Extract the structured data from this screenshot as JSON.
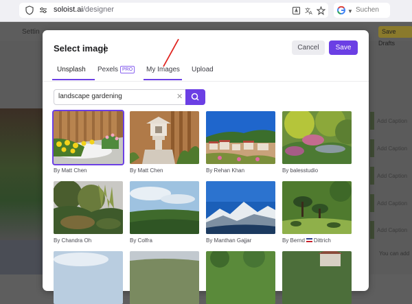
{
  "browser": {
    "url_domain": "soloist.ai",
    "url_path": "/designer",
    "search_placeholder": "Suchen"
  },
  "background": {
    "settings_label": "Settin",
    "save_draft_label": "Save Drafts",
    "caption_label": "Add Caption",
    "you_can_text": "You can add"
  },
  "modal": {
    "title": "Select image",
    "cancel_label": "Cancel",
    "save_label": "Save",
    "tabs": [
      {
        "label": "Unsplash",
        "active": true
      },
      {
        "label": "Pexels",
        "badge": "PRO",
        "active": false
      },
      {
        "label": "My Images",
        "active": false
      },
      {
        "label": "Upload",
        "active": false
      }
    ],
    "search": {
      "value": "landscape gardening",
      "clear_icon": "close-icon",
      "button_icon": "search-icon"
    },
    "images": [
      {
        "credit": "By Matt Chen",
        "selected": true
      },
      {
        "credit": "By Matt Chen"
      },
      {
        "credit": "By Rehan Khan"
      },
      {
        "credit": "By balesstudio"
      },
      {
        "credit": "By Chandra Oh"
      },
      {
        "credit": "By Colfra"
      },
      {
        "credit": "By Manthan Gajjar"
      },
      {
        "credit_a": "By Bernd",
        "credit_b": "Dittrich"
      }
    ]
  },
  "colors": {
    "accent": "#6b3fe4",
    "annotation": "#e0231e"
  }
}
